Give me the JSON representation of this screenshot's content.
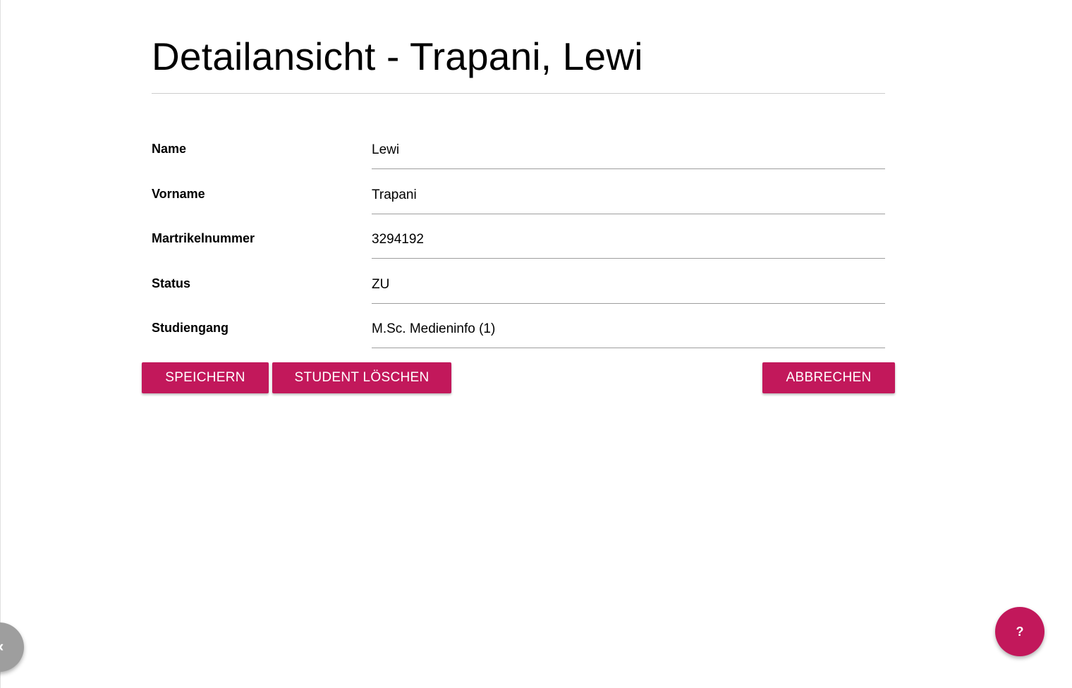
{
  "page": {
    "title": "Detailansicht - Trapani, Lewi"
  },
  "form": {
    "fields": [
      {
        "label": "Name",
        "value": "Lewi"
      },
      {
        "label": "Vorname",
        "value": "Trapani"
      },
      {
        "label": "Martrikelnummer",
        "value": "3294192"
      },
      {
        "label": "Status",
        "value": "ZU"
      },
      {
        "label": "Studiengang",
        "value": "M.Sc. Medieninfo (1)"
      }
    ]
  },
  "actions": {
    "save_label": "Speichern",
    "delete_label": "Student löschen",
    "cancel_label": "Abbrechen"
  },
  "fab": {
    "help_label": "?",
    "side_icon": "chevron-left-icon",
    "side_glyph": "‹"
  },
  "colors": {
    "accent": "#c2185b",
    "side_fab": "#9e9e9e"
  }
}
